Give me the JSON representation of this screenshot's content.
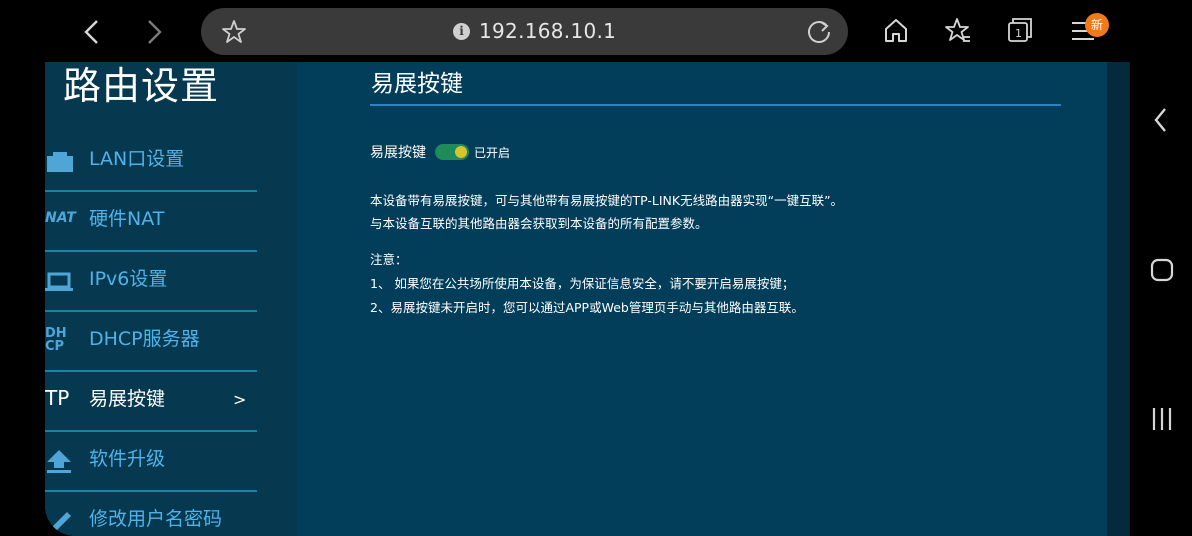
{
  "browser": {
    "url": "192.168.10.1",
    "menu_badge": "新"
  },
  "sidebar": {
    "title": "路由设置",
    "items": [
      {
        "label": "LAN口设置",
        "icon": "network-port-icon"
      },
      {
        "label": "硬件NAT",
        "icon": "nat-icon",
        "icon_text": "NAT"
      },
      {
        "label": "IPv6设置",
        "icon": "laptop-icon"
      },
      {
        "label": "DHCP服务器",
        "icon": "dhcp-icon",
        "icon_text": "DH CP"
      },
      {
        "label": "易展按键",
        "icon": "tp-icon",
        "icon_text": "TP",
        "active": true,
        "arrow": ">"
      },
      {
        "label": "软件升级",
        "icon": "upload-icon"
      },
      {
        "label": "修改用户名密码",
        "icon": "pencil-icon"
      }
    ]
  },
  "main": {
    "title": "易展按键",
    "switch_label": "易展按键",
    "switch_state": "已开启",
    "switch_on": true,
    "desc_line1": "本设备带有易展按键，可与其他带有易展按键的TP-LINK无线路由器实现“一键互联”。",
    "desc_line2": "与本设备互联的其他路由器会获取到本设备的所有配置参数。",
    "note_title": "注意：",
    "note_1": "1、 如果您在公共场所使用本设备，为保证信息安全，请不要开启易展按键；",
    "note_2": "2、易展按键未开启时，您可以通过APP或Web管理页手动与其他路由器互联。"
  },
  "colors": {
    "sidebar_bg": "#06394f",
    "content_bg": "#023d5a",
    "accent": "#4fb3ea",
    "toggle_on": "#1f8a5a"
  }
}
